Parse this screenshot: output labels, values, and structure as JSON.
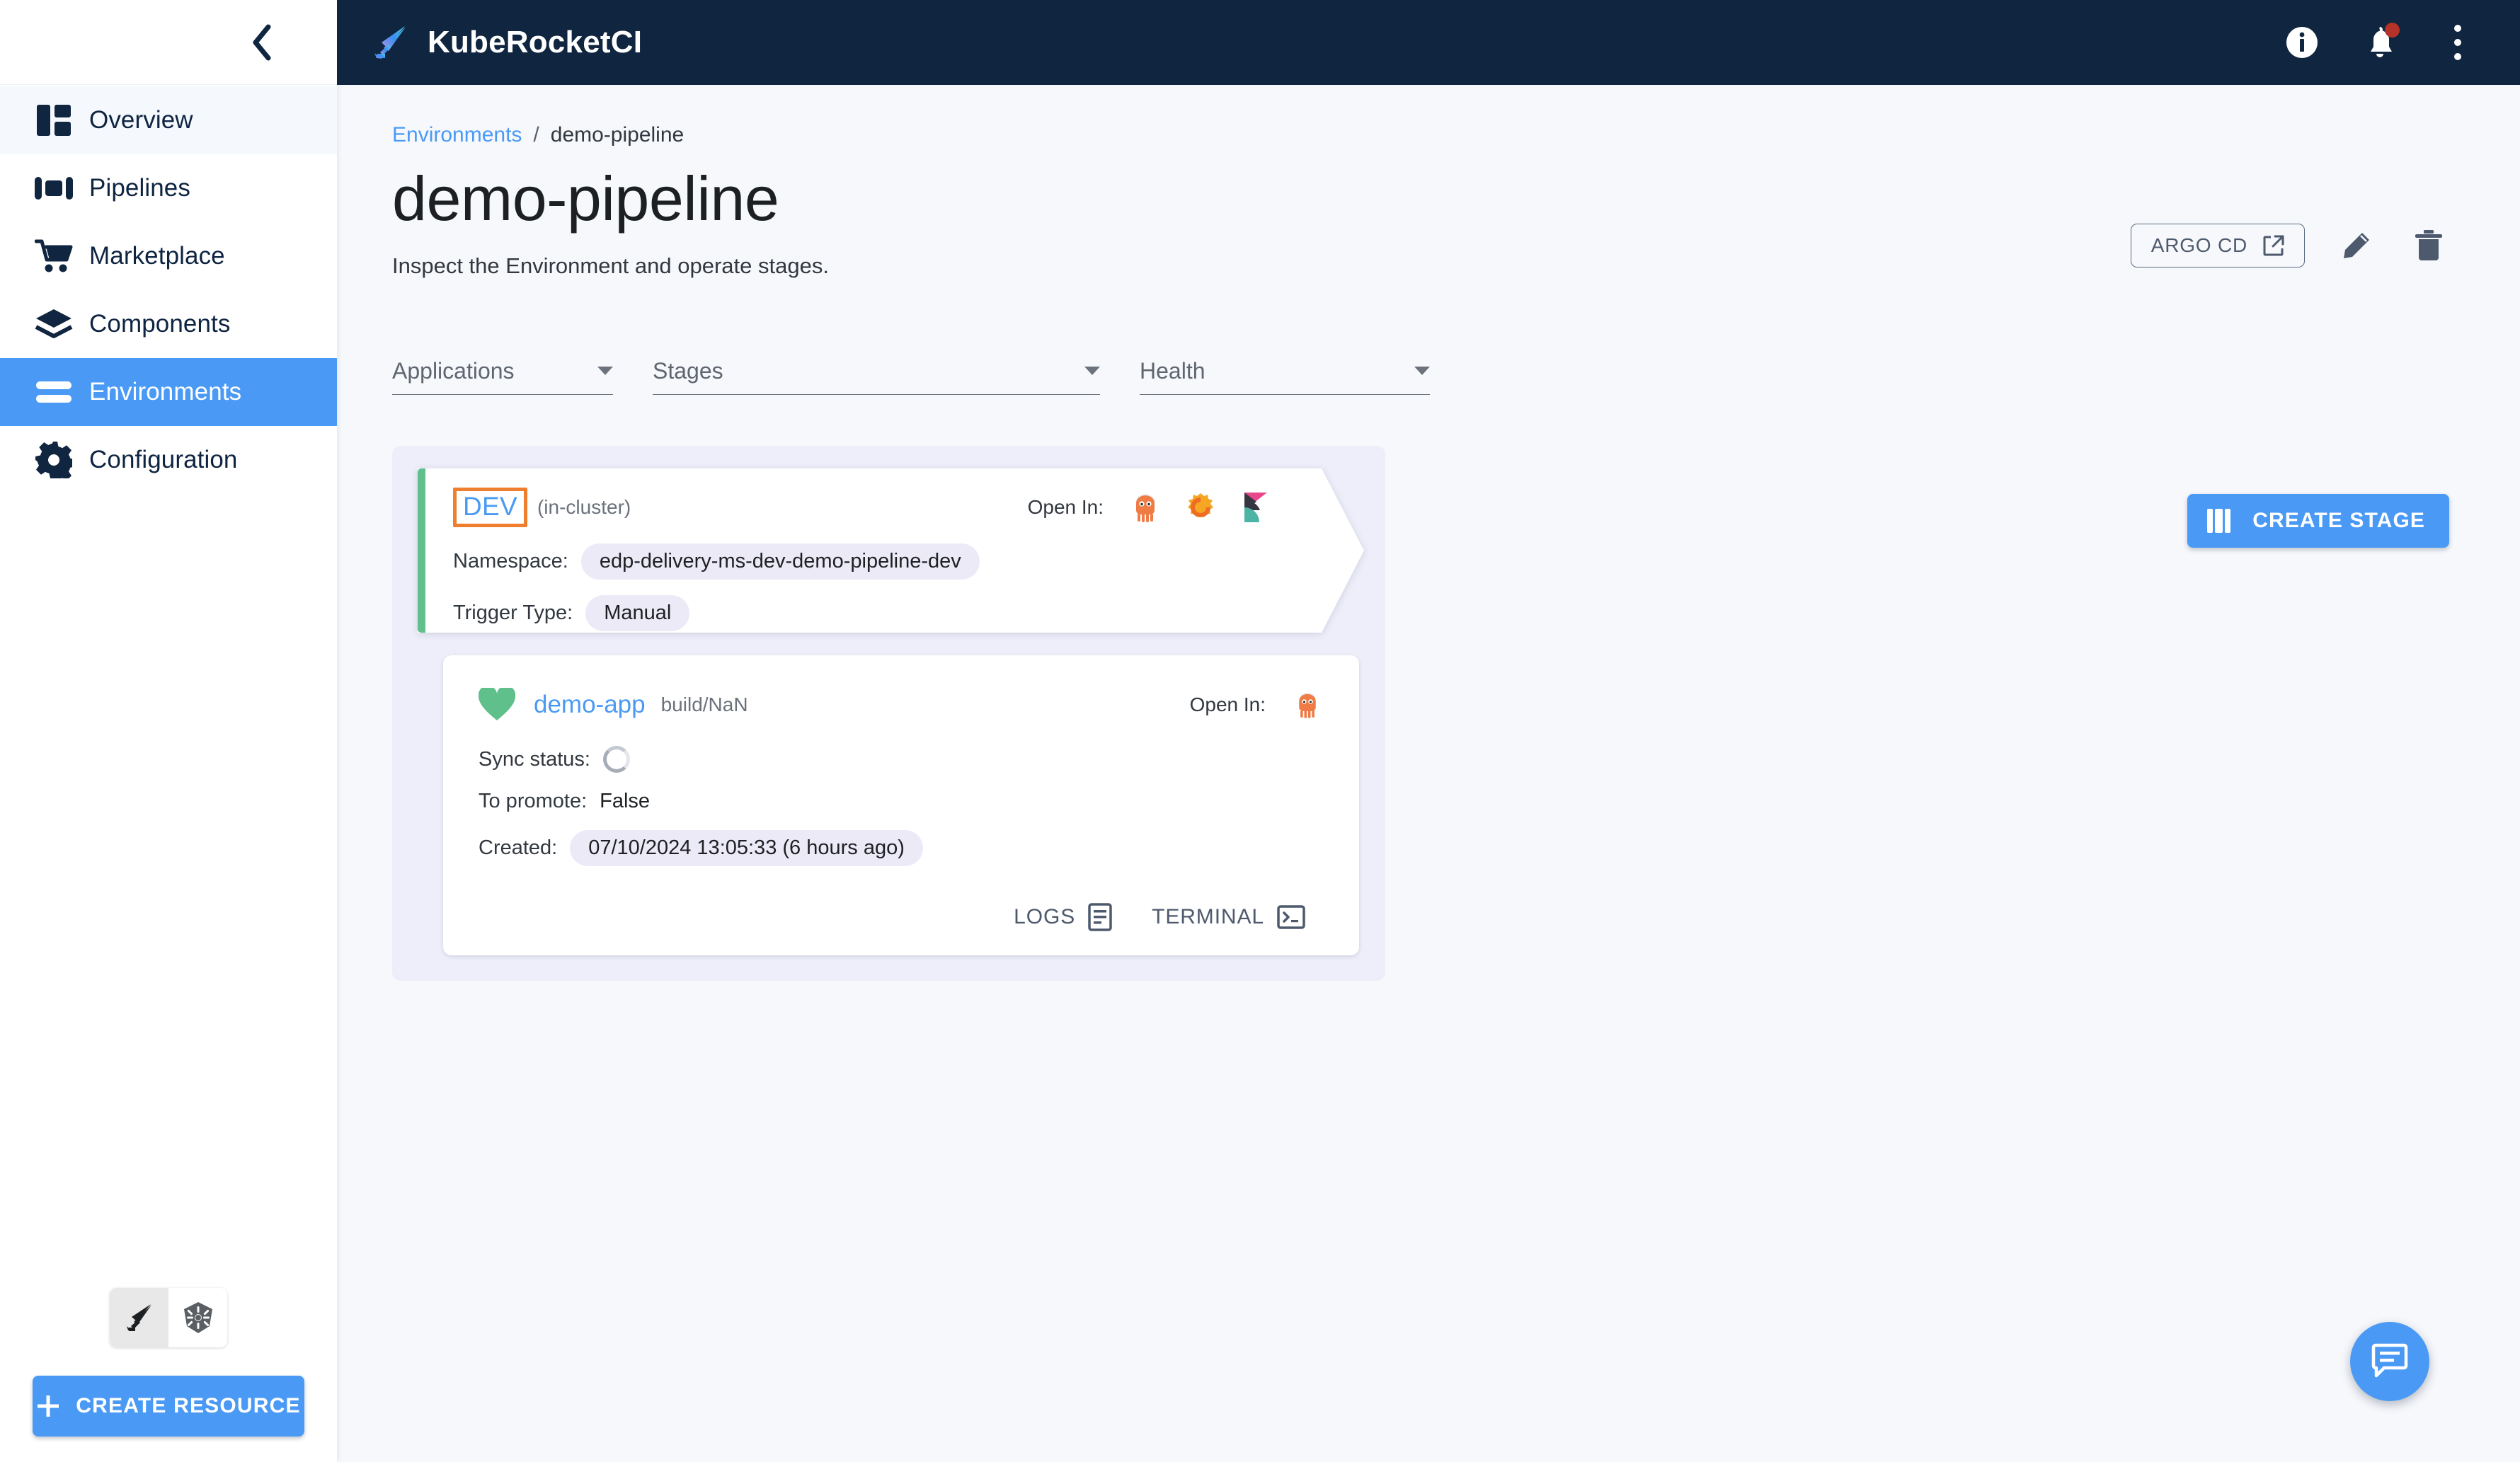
{
  "app": {
    "brand_name": "KubeRocketCI",
    "brand_icon": "rocket-feather-logo"
  },
  "topbar": {
    "info_icon": "info-circle-icon",
    "notifications_icon": "bell-icon",
    "notifications_badge": true,
    "more_icon": "kebab-menu-icon"
  },
  "sidebar": {
    "collapse_icon": "chevron-left-icon",
    "items": [
      {
        "label": "Overview",
        "icon": "dashboard-icon",
        "state": "hovered"
      },
      {
        "label": "Pipelines",
        "icon": "pipelines-icon",
        "state": "default"
      },
      {
        "label": "Marketplace",
        "icon": "cart-icon",
        "state": "default"
      },
      {
        "label": "Components",
        "icon": "layers-icon",
        "state": "default"
      },
      {
        "label": "Environments",
        "icon": "environments-icon",
        "state": "active"
      },
      {
        "label": "Configuration",
        "icon": "gear-icon",
        "state": "default"
      }
    ],
    "cluster_switch": {
      "options": [
        {
          "icon": "kuberocketci-icon",
          "selected": true
        },
        {
          "icon": "kubernetes-icon",
          "selected": false
        }
      ]
    },
    "create_resource_label": "CREATE RESOURCE",
    "create_resource_icon": "plus-icon"
  },
  "page": {
    "breadcrumb": {
      "root": "Environments",
      "separator": "/",
      "current": "demo-pipeline"
    },
    "title": "demo-pipeline",
    "subtitle": "Inspect the Environment and operate stages.",
    "actions": {
      "argo_cd_label": "ARGO CD",
      "argo_cd_icon": "external-link-icon",
      "edit_icon": "pencil-icon",
      "delete_icon": "trash-icon"
    }
  },
  "filters": [
    {
      "label": "Applications",
      "value": "",
      "caret": "chevron-down-icon"
    },
    {
      "label": "Stages",
      "value": "",
      "caret": "chevron-down-icon"
    },
    {
      "label": "Health",
      "value": "",
      "caret": "chevron-down-icon"
    }
  ],
  "create_stage": {
    "label": "CREATE STAGE",
    "icon": "columns-icon"
  },
  "stage": {
    "name": "DEV",
    "cluster_note": "(in-cluster)",
    "accent_color": "#5fc08c",
    "focus_outline_color": "#ef7f2e",
    "open_in_label": "Open In:",
    "open_in_icons": [
      "argocd-icon",
      "grafana-icon",
      "kibana-icon"
    ],
    "fields": [
      {
        "key": "Namespace:",
        "value": "edp-delivery-ms-dev-demo-pipeline-dev",
        "chip": true
      },
      {
        "key": "Trigger Type:",
        "value": "Manual",
        "chip": true
      }
    ]
  },
  "application": {
    "health_icon": "heart-icon",
    "health_color": "#5fc08c",
    "name": "demo-app",
    "build": "build/NaN",
    "open_in_label": "Open In:",
    "open_in_icons": [
      "argocd-icon"
    ],
    "fields": [
      {
        "key": "Sync status:",
        "value": "",
        "kind": "spinner"
      },
      {
        "key": "To promote:",
        "value": "False",
        "kind": "plain"
      },
      {
        "key": "Created:",
        "value": "07/10/2024 13:05:33 (6 hours ago)",
        "kind": "chip"
      }
    ],
    "actions": [
      {
        "label": "LOGS",
        "icon": "logs-icon"
      },
      {
        "label": "TERMINAL",
        "icon": "terminal-icon"
      }
    ]
  },
  "chat": {
    "icon": "chat-bubble-icon"
  },
  "colors": {
    "brand_dark": "#10253f",
    "accent_blue": "#4a9af5",
    "page_bg": "#f7f8fc",
    "board_bg": "#eeeefa",
    "chip_bg": "#eceaf7"
  }
}
